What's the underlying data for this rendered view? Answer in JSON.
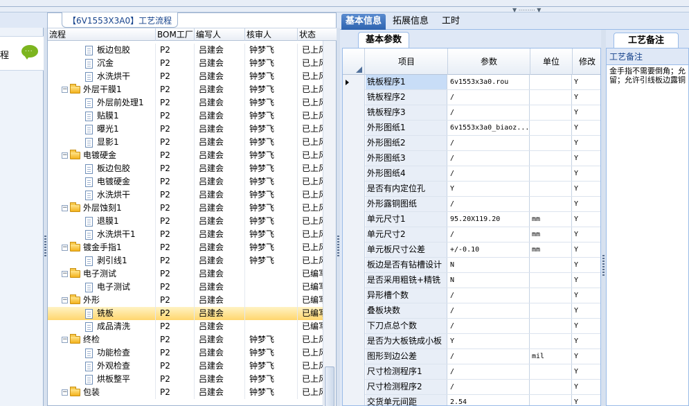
{
  "nav": {
    "label": "程",
    "chat_icon_text": "..."
  },
  "tree": {
    "title": "【6V1553X3A0】工艺流程",
    "columns": [
      "流程",
      "BOM工厂",
      "编写人",
      "核审人",
      "状态"
    ],
    "rows": [
      {
        "name": "板边包胶",
        "level": 2,
        "kind": "doc",
        "bom": "P2",
        "writer": "吕建会",
        "reviewer": "钟梦飞",
        "status": "已上风"
      },
      {
        "name": "沉金",
        "level": 2,
        "kind": "doc",
        "bom": "P2",
        "writer": "吕建会",
        "reviewer": "钟梦飞",
        "status": "已上风"
      },
      {
        "name": "水洗烘干",
        "level": 2,
        "kind": "doc",
        "bom": "P2",
        "writer": "吕建会",
        "reviewer": "钟梦飞",
        "status": "已上风"
      },
      {
        "name": "外层干膜1",
        "level": 1,
        "kind": "folder",
        "bom": "P2",
        "writer": "吕建会",
        "reviewer": "钟梦飞",
        "status": "已上风"
      },
      {
        "name": "外层前处理1",
        "level": 2,
        "kind": "doc",
        "bom": "P2",
        "writer": "吕建会",
        "reviewer": "钟梦飞",
        "status": "已上风"
      },
      {
        "name": "贴膜1",
        "level": 2,
        "kind": "doc",
        "bom": "P2",
        "writer": "吕建会",
        "reviewer": "钟梦飞",
        "status": "已上风"
      },
      {
        "name": "曝光1",
        "level": 2,
        "kind": "doc",
        "bom": "P2",
        "writer": "吕建会",
        "reviewer": "钟梦飞",
        "status": "已上风"
      },
      {
        "name": "显影1",
        "level": 2,
        "kind": "doc",
        "bom": "P2",
        "writer": "吕建会",
        "reviewer": "钟梦飞",
        "status": "已上风"
      },
      {
        "name": "电镀硬金",
        "level": 1,
        "kind": "folder",
        "bom": "P2",
        "writer": "吕建会",
        "reviewer": "钟梦飞",
        "status": "已上风"
      },
      {
        "name": "板边包胶",
        "level": 2,
        "kind": "doc",
        "bom": "P2",
        "writer": "吕建会",
        "reviewer": "钟梦飞",
        "status": "已上风"
      },
      {
        "name": "电镀硬金",
        "level": 2,
        "kind": "doc",
        "bom": "P2",
        "writer": "吕建会",
        "reviewer": "钟梦飞",
        "status": "已上风"
      },
      {
        "name": "水洗烘干",
        "level": 2,
        "kind": "doc",
        "bom": "P2",
        "writer": "吕建会",
        "reviewer": "钟梦飞",
        "status": "已上风"
      },
      {
        "name": "外层蚀刻1",
        "level": 1,
        "kind": "folder",
        "bom": "P2",
        "writer": "吕建会",
        "reviewer": "钟梦飞",
        "status": "已上风"
      },
      {
        "name": "退膜1",
        "level": 2,
        "kind": "doc",
        "bom": "P2",
        "writer": "吕建会",
        "reviewer": "钟梦飞",
        "status": "已上风"
      },
      {
        "name": "水洗烘干1",
        "level": 2,
        "kind": "doc",
        "bom": "P2",
        "writer": "吕建会",
        "reviewer": "钟梦飞",
        "status": "已上风"
      },
      {
        "name": "镀金手指1",
        "level": 1,
        "kind": "folder",
        "bom": "P2",
        "writer": "吕建会",
        "reviewer": "钟梦飞",
        "status": "已上风"
      },
      {
        "name": "剥引线1",
        "level": 2,
        "kind": "doc",
        "bom": "P2",
        "writer": "吕建会",
        "reviewer": "钟梦飞",
        "status": "已上风"
      },
      {
        "name": "电子测试",
        "level": 1,
        "kind": "folder",
        "bom": "P2",
        "writer": "吕建会",
        "reviewer": "",
        "status": "已编写"
      },
      {
        "name": "电子测试",
        "level": 2,
        "kind": "doc",
        "bom": "P2",
        "writer": "吕建会",
        "reviewer": "",
        "status": "已编写"
      },
      {
        "name": "外形",
        "level": 1,
        "kind": "folder",
        "bom": "P2",
        "writer": "吕建会",
        "reviewer": "",
        "status": "已编写"
      },
      {
        "name": "铣板",
        "level": 2,
        "kind": "doc",
        "bom": "P2",
        "writer": "吕建会",
        "reviewer": "",
        "status": "已编写",
        "selected": true
      },
      {
        "name": "成品清洗",
        "level": 2,
        "kind": "doc",
        "bom": "P2",
        "writer": "吕建会",
        "reviewer": "",
        "status": "已编写"
      },
      {
        "name": "终检",
        "level": 1,
        "kind": "folder",
        "bom": "P2",
        "writer": "吕建会",
        "reviewer": "钟梦飞",
        "status": "已上风"
      },
      {
        "name": "功能检查",
        "level": 2,
        "kind": "doc",
        "bom": "P2",
        "writer": "吕建会",
        "reviewer": "钟梦飞",
        "status": "已上风"
      },
      {
        "name": "外观检查",
        "level": 2,
        "kind": "doc",
        "bom": "P2",
        "writer": "吕建会",
        "reviewer": "钟梦飞",
        "status": "已上风"
      },
      {
        "name": "烘板整平",
        "level": 2,
        "kind": "doc",
        "bom": "P2",
        "writer": "吕建会",
        "reviewer": "钟梦飞",
        "status": "已上风"
      },
      {
        "name": "包装",
        "level": 1,
        "kind": "folder",
        "bom": "P2",
        "writer": "吕建会",
        "reviewer": "钟梦飞",
        "status": "已上风"
      }
    ]
  },
  "main": {
    "tabs": [
      "基本信息",
      "拓展信息",
      "工时"
    ],
    "active_tab": 0,
    "subtab": "基本参数",
    "grid": {
      "columns": [
        "项目",
        "参数",
        "单位",
        "修改"
      ],
      "rows": [
        {
          "item": "铣板程序1",
          "value": "6v1553x3a0.rou",
          "unit": "",
          "mod": "Y",
          "current": true
        },
        {
          "item": "铣板程序2",
          "value": "/",
          "unit": "",
          "mod": "Y"
        },
        {
          "item": "铣板程序3",
          "value": "/",
          "unit": "",
          "mod": "Y"
        },
        {
          "item": "外形图纸1",
          "value": "6v1553x3a0_biaoz...",
          "unit": "",
          "mod": "Y"
        },
        {
          "item": "外形图纸2",
          "value": "/",
          "unit": "",
          "mod": "Y"
        },
        {
          "item": "外形图纸3",
          "value": "/",
          "unit": "",
          "mod": "Y"
        },
        {
          "item": "外形图纸4",
          "value": "/",
          "unit": "",
          "mod": "Y"
        },
        {
          "item": "是否有内定位孔",
          "value": "Y",
          "unit": "",
          "mod": "Y"
        },
        {
          "item": "外形露铜图纸",
          "value": "/",
          "unit": "",
          "mod": "Y"
        },
        {
          "item": "单元尺寸1",
          "value": "95.20X119.20",
          "unit": "mm",
          "mod": "Y"
        },
        {
          "item": "单元尺寸2",
          "value": "/",
          "unit": "mm",
          "mod": "Y"
        },
        {
          "item": "单元板尺寸公差",
          "value": "+/-0.10",
          "unit": "mm",
          "mod": "Y"
        },
        {
          "item": "板边是否有钻槽设计",
          "value": "N",
          "unit": "",
          "mod": "Y"
        },
        {
          "item": "是否采用粗铣+精铣",
          "value": "N",
          "unit": "",
          "mod": "Y"
        },
        {
          "item": "异形槽个数",
          "value": "/",
          "unit": "",
          "mod": "Y"
        },
        {
          "item": "叠板块数",
          "value": "/",
          "unit": "",
          "mod": "Y"
        },
        {
          "item": "下刀点总个数",
          "value": "/",
          "unit": "",
          "mod": "Y"
        },
        {
          "item": "是否为大板铣成小板",
          "value": "Y",
          "unit": "",
          "mod": "Y"
        },
        {
          "item": "图形到边公差",
          "value": "/",
          "unit": "mil",
          "mod": "Y"
        },
        {
          "item": "尺寸检测程序1",
          "value": "/",
          "unit": "",
          "mod": "Y"
        },
        {
          "item": "尺寸检测程序2",
          "value": "/",
          "unit": "",
          "mod": "Y"
        },
        {
          "item": "交货单元间距",
          "value": "2.54",
          "unit": "",
          "mod": "Y"
        }
      ]
    },
    "notes": {
      "tab": "工艺备注",
      "title": "工艺备注",
      "lines": [
        "金手指不需要倒角；允",
        "留；允许引线板边露铜"
      ]
    }
  }
}
